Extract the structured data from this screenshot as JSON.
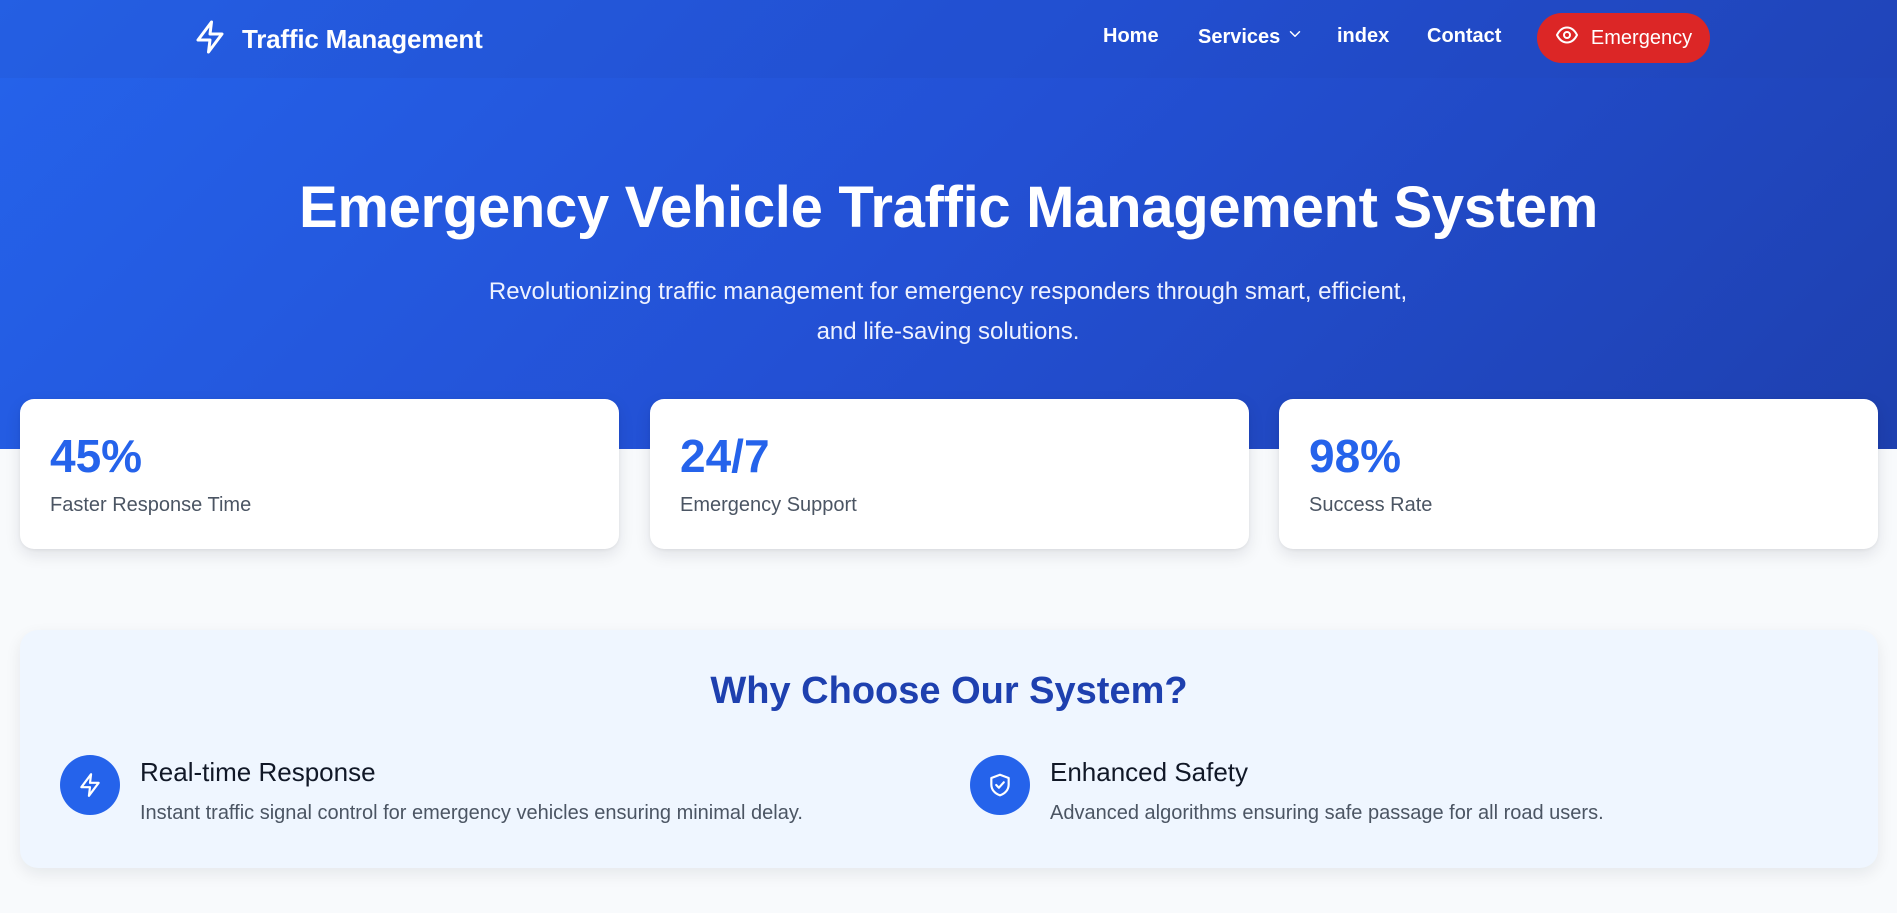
{
  "nav": {
    "brand": "Traffic Management",
    "brand_icon": "lightning-bolt-icon",
    "links": [
      "Home",
      "Services",
      "index",
      "Contact"
    ],
    "emergency_label": "Emergency",
    "emergency_icon": "eye-icon",
    "services_icon": "chevron-down-icon"
  },
  "hero": {
    "title": "Emergency Vehicle Traffic Management System",
    "subtitle_line1": "Revolutionizing traffic management for emergency responders through smart, efficient,",
    "subtitle_line2": "and life-saving solutions."
  },
  "stats": [
    {
      "value": "45%",
      "label": "Faster Response Time"
    },
    {
      "value": "24/7",
      "label": "Emergency Support"
    },
    {
      "value": "98%",
      "label": "Success Rate"
    }
  ],
  "features": {
    "title": "Why Choose Our System?",
    "items": [
      {
        "icon": "lightning-bolt-icon",
        "title": "Real-time Response",
        "description": "Instant traffic signal control for emergency vehicles ensuring minimal delay."
      },
      {
        "icon": "shield-check-icon",
        "title": "Enhanced Safety",
        "description": "Advanced algorithms ensuring safe passage for all road users."
      }
    ]
  },
  "colors": {
    "primary": "#2563eb",
    "primary_dark": "#1e40af",
    "emergency": "#dc2626",
    "features_bg": "#eff6ff",
    "page_bg": "#f8fafc"
  }
}
